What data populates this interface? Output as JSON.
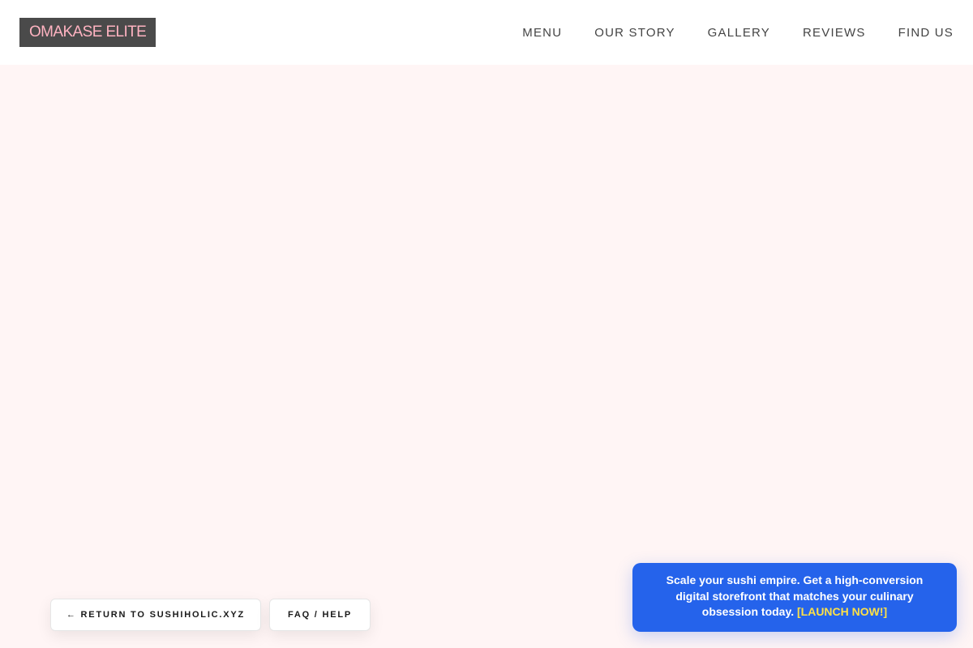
{
  "header": {
    "logo": "OMAKASE ELITE",
    "nav": [
      {
        "label": "MENU"
      },
      {
        "label": "OUR STORY"
      },
      {
        "label": "GALLERY"
      },
      {
        "label": "REVIEWS"
      },
      {
        "label": "FIND US"
      }
    ]
  },
  "footer_buttons": {
    "return_label": "← RETURN TO SUSHIHOLIC.XYZ",
    "faq_label": "FAQ / HELP"
  },
  "promo": {
    "text": "Scale your sushi empire. Get a high-conversion digital storefront that matches your culinary obsession today.",
    "cta": "[LAUNCH NOW!]"
  },
  "colors": {
    "page_background": "#fff5f5",
    "logo_background": "#4a4a4a",
    "logo_text": "#ffb3c1",
    "promo_background": "#2563eb",
    "promo_cta": "#fde047"
  }
}
